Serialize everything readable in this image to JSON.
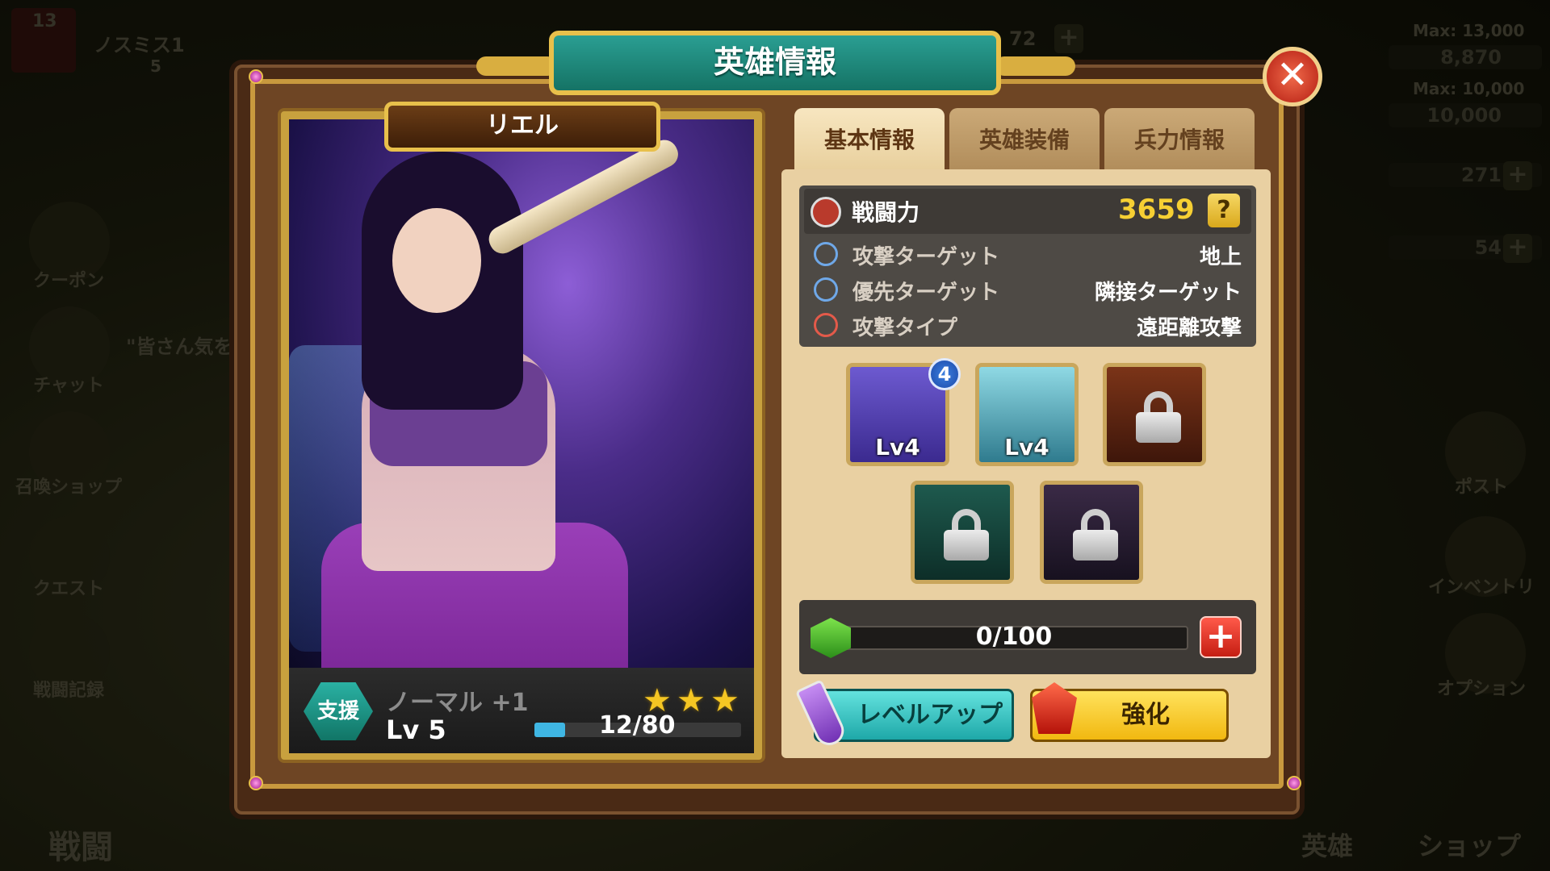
{
  "background_hud": {
    "player_name": "ノスミス1",
    "player_rank": "13",
    "player_sub": "5",
    "gold_max": "Max: 13,000",
    "gold_value": "8,870",
    "elixir_max": "Max: 10,000",
    "elixir_value": "10,000",
    "trophy_value": "271",
    "gem_value": "54",
    "top_center_value": "72",
    "chat_snippet": "\"皆さん気を",
    "left_menu": [
      "クーポン",
      "チャット",
      "召喚ショップ",
      "クエスト",
      "戦闘記録"
    ],
    "right_menu": [
      "ポスト",
      "インベントリ",
      "オプション"
    ],
    "bottom_left": "戦闘",
    "bottom_right": [
      "英雄",
      "ショップ"
    ]
  },
  "dialog": {
    "title": "英雄情報",
    "close_label": "✕"
  },
  "hero": {
    "name": "リエル",
    "role": "支援",
    "rarity": "ノーマル +1",
    "level": "Lv 5",
    "stars": 3,
    "xp_text": "12/80",
    "xp_fraction": 0.15
  },
  "tabs": [
    {
      "label": "基本情報",
      "active": true
    },
    {
      "label": "英雄装備",
      "active": false
    },
    {
      "label": "兵力情報",
      "active": false
    }
  ],
  "stats": {
    "power_label": "戦闘力",
    "power_value": "3659",
    "help_label": "?",
    "rows": [
      {
        "label": "攻撃ターゲット",
        "value": "地上",
        "icon": "crosshair-icon"
      },
      {
        "label": "優先ターゲット",
        "value": "隣接ターゲット",
        "icon": "cross-target-icon"
      },
      {
        "label": "攻撃タイプ",
        "value": "遠距離攻撃",
        "icon": "skull-icon"
      }
    ]
  },
  "equipment": [
    {
      "name": "ankh-staff",
      "level": "Lv4",
      "badge": "4",
      "locked": false,
      "color": "#5b4ab8"
    },
    {
      "name": "feather",
      "level": "Lv4",
      "locked": false,
      "color": "#5fb3c4"
    },
    {
      "name": "sword-slot",
      "locked": true,
      "color": "#6a2a14"
    },
    {
      "name": "leaf-slot",
      "locked": true,
      "color": "#17463d"
    },
    {
      "name": "shield-slot",
      "locked": true,
      "color": "#2a1d33"
    }
  ],
  "gem_progress": {
    "text": "0/100",
    "fraction": 0,
    "plus_label": "+"
  },
  "buttons": {
    "level_up": "レベルアップ",
    "enhance": "強化"
  }
}
